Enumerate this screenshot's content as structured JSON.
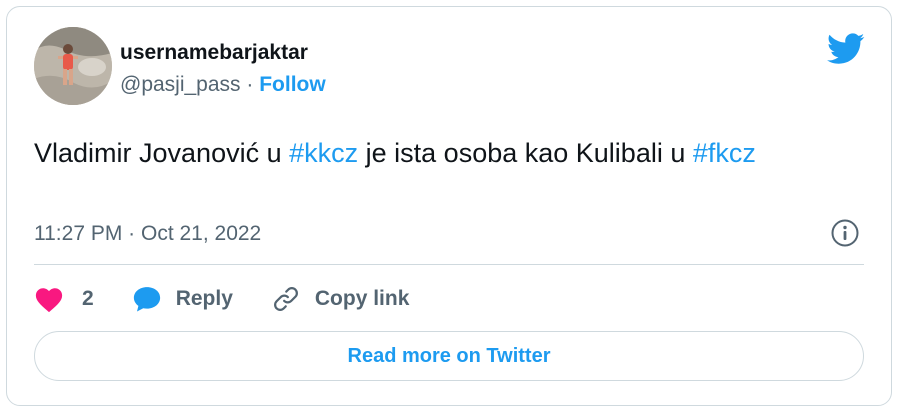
{
  "author": {
    "name": "usernamebarjaktar",
    "handle": "@pasji_pass",
    "separator": "·",
    "follow_label": "Follow"
  },
  "tweet": {
    "text_segments": [
      {
        "text": "Vladimir Jovanović u ",
        "type": "text"
      },
      {
        "text": "#kkcz",
        "type": "hashtag"
      },
      {
        "text": " je ista osoba kao Kulibali u ",
        "type": "text"
      },
      {
        "text": "#fkcz",
        "type": "hashtag"
      }
    ],
    "timestamp": "11:27 PM · Oct 21, 2022"
  },
  "actions": {
    "like_count": "2",
    "reply_label": "Reply",
    "copy_link_label": "Copy link"
  },
  "read_more_label": "Read more on Twitter",
  "icons": {
    "brand": "twitter-bird-icon",
    "info": "info-icon",
    "like": "heart-icon",
    "reply": "speech-bubble-icon",
    "copy": "link-icon"
  },
  "colors": {
    "brand_blue": "#1d9bf0",
    "heart_red": "#f91880",
    "text_primary": "#0f1419",
    "text_secondary": "#536471",
    "border": "#cfd9de"
  }
}
